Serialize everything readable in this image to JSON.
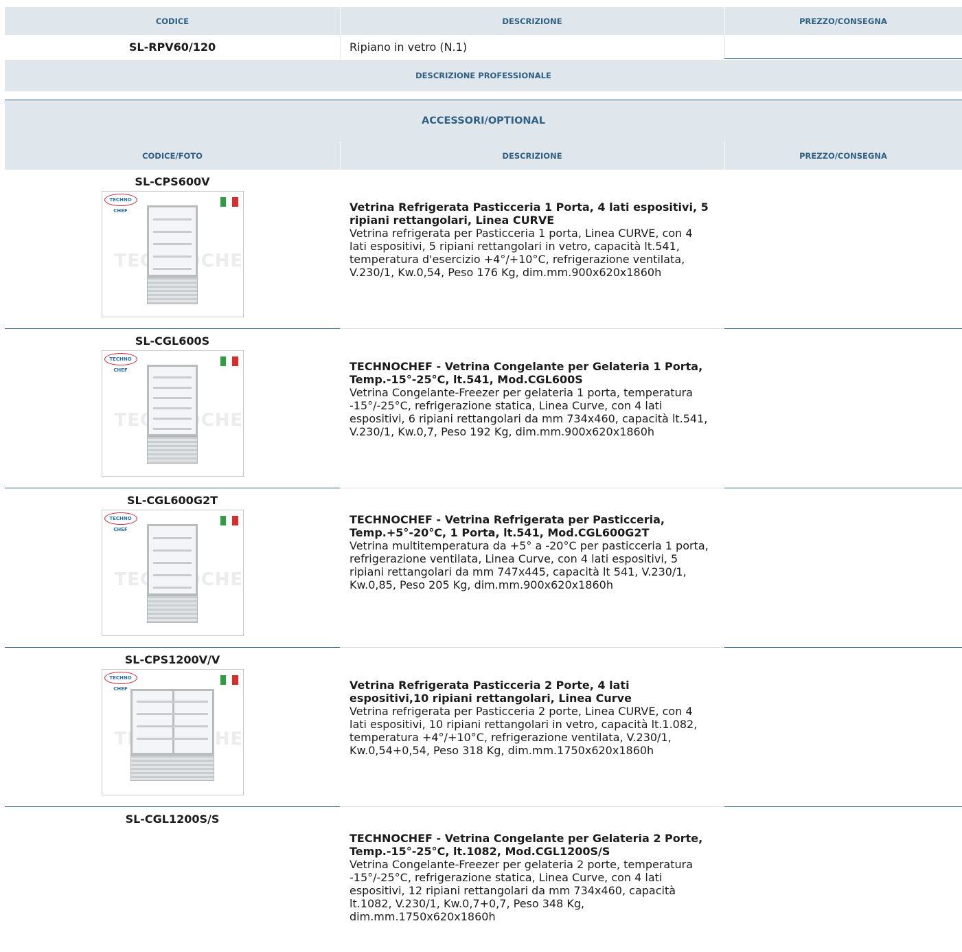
{
  "top_table": {
    "headers": [
      "CODICE",
      "DESCRIZIONE",
      "PREZZO/CONSEGNA"
    ],
    "row": {
      "code": "SL-RPV60/120",
      "description": "Ripiano in vetro (N.1)",
      "price": ""
    }
  },
  "professional_label": "DESCRIZIONE PROFESSIONALE",
  "accessories": {
    "title": "ACCESSORI/OPTIONAL",
    "headers": [
      "CODICE/FOTO",
      "DESCRIZIONE",
      "PREZZO/CONSEGNA"
    ],
    "photo_watermark": "TECHNOCHEF.IT",
    "logo_text": "TECHNO CHEF",
    "flag_colors": [
      "#2e9e43",
      "#ffffff",
      "#d62d2d"
    ],
    "items": [
      {
        "code": "SL-CPS600V",
        "has_photo": true,
        "title": "Vetrina Refrigerata Pasticceria 1 Porta, 4 lati espositivi, 5 ripiani rettangolari, Linea CURVE",
        "text": "Vetrina refrigerata per Pasticceria 1 porta, Linea CURVE, con 4 lati espositivi, 5 ripiani rettangolari in vetro, capacità lt.541, temperatura d'esercizio +4°/+10°C, refrigerazione ventilata, V.230/1, Kw.0,54, Peso 176 Kg, dim.mm.900x620x1860h",
        "price": ""
      },
      {
        "code": "SL-CGL600S",
        "has_photo": true,
        "title": "TECHNOCHEF - Vetrina Congelante per Gelateria 1 Porta, Temp.-15°-25°C, lt.541, Mod.CGL600S",
        "text": "Vetrina Congelante-Freezer per gelateria 1 porta, temperatura -15°/-25°C, refrigerazione statica, Linea Curve, con 4 lati espositivi, 6 ripiani rettangolari da mm 734x460, capacità lt.541, V.230/1, Kw.0,7, Peso 192 Kg, dim.mm.900x620x1860h",
        "price": ""
      },
      {
        "code": "SL-CGL600G2T",
        "has_photo": true,
        "title": "TECHNOCHEF - Vetrina Refrigerata per Pasticceria, Temp.+5°-20°C, 1 Porta, lt.541, Mod.CGL600G2T",
        "text": "Vetrina multitemperatura da +5° a -20°C per pasticceria 1 porta, refrigerazione ventilata, Linea Curve, con 4 lati espositivi, 5 ripiani rettangolari da mm 747x445, capacità lt 541, V.230/1, Kw.0,85, Peso 205 Kg, dim.mm.900x620x1860h",
        "price": ""
      },
      {
        "code": "SL-CPS1200V/V",
        "has_photo": true,
        "title": "Vetrina Refrigerata Pasticceria 2 Porte, 4 lati espositivi,10 ripiani rettangolari, Linea Curve",
        "text": "Vetrina refrigerata per Pasticceria 2 porte, Linea CURVE, con 4 lati espositivi, 10 ripiani rettangolari in vetro, capacità lt.1.082, temperatura +4°/+10°C, refrigerazione ventilata, V.230/1, Kw.0,54+0,54, Peso 318 Kg, dim.mm.1750x620x1860h",
        "price": ""
      },
      {
        "code": "SL-CGL1200S/S",
        "has_photo": false,
        "title": "TECHNOCHEF - Vetrina Congelante per Gelateria 2 Porte, Temp.-15°-25°C, lt.1082, Mod.CGL1200S/S",
        "text": "Vetrina Congelante-Freezer per gelateria 2 porte, temperatura -15°/-25°C, refrigerazione statica, Linea Curve, con 4 lati espositivi, 12 ripiani rettangolari da mm 734x460, capacità lt.1082, V.230/1, Kw.0,7+0,7, Peso 348 Kg, dim.mm.1750x620x1860h",
        "price": ""
      }
    ]
  }
}
